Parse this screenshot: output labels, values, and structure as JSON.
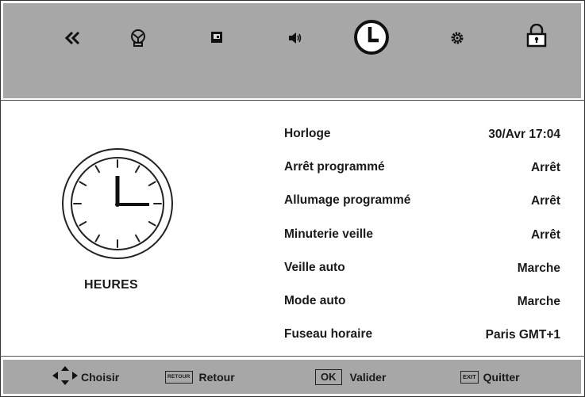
{
  "top_nav": {
    "icons": [
      "back-icon",
      "picture-icon",
      "source-icon",
      "sound-icon",
      "clock-icon",
      "settings-icon",
      "lock-icon"
    ],
    "active_icon": "clock-icon"
  },
  "section": {
    "title": "HEURES"
  },
  "menu": {
    "items": [
      {
        "label": "Horloge",
        "value": "30/Avr 17:04"
      },
      {
        "label": "Arrêt programmé",
        "value": "Arrêt"
      },
      {
        "label": "Allumage programmé",
        "value": "Arrêt"
      },
      {
        "label": "Minuterie veille",
        "value": "Arrêt"
      },
      {
        "label": "Veille auto",
        "value": "Marche"
      },
      {
        "label": "Mode auto",
        "value": "Marche"
      },
      {
        "label": "Fuseau horaire",
        "value": "Paris GMT+1"
      }
    ]
  },
  "footer": {
    "choose": {
      "label": "Choisir"
    },
    "back": {
      "key": "RETOUR",
      "label": "Retour"
    },
    "ok": {
      "key": "OK",
      "label": "Valider"
    },
    "exit": {
      "key": "EXIT",
      "label": "Quitter"
    }
  },
  "colors": {
    "bar": "#a7a7a7",
    "text": "#1a1a1a"
  }
}
